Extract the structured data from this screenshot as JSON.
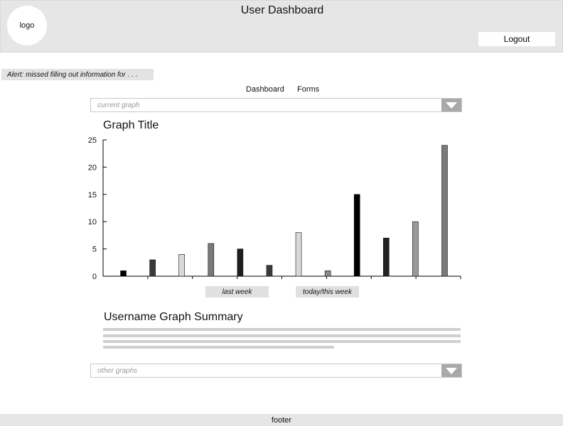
{
  "header": {
    "logo_text": "logo",
    "title": "User Dashboard",
    "logout_label": "Logout"
  },
  "alert": {
    "text": "Alert: missed filling out information for . . ."
  },
  "nav": {
    "items": [
      {
        "label": "Dashboard"
      },
      {
        "label": "Forms"
      }
    ]
  },
  "graph_select": {
    "placeholder": "current graph",
    "arrow_icon": "chevron-down-icon"
  },
  "graph": {
    "title": "Graph Title",
    "week_labels": [
      "last week",
      "today/this week"
    ]
  },
  "chart_data": {
    "type": "bar",
    "title": "Graph Title",
    "xlabel": "",
    "ylabel": "",
    "ylim": [
      0,
      25
    ],
    "yticks": [
      0,
      5,
      10,
      15,
      20,
      25
    ],
    "grid": false,
    "bars": [
      {
        "value": 1,
        "color": "#000000"
      },
      {
        "value": 3,
        "color": "#3a3a3a"
      },
      {
        "value": 4,
        "color": "#d9d9d9"
      },
      {
        "value": 6,
        "color": "#7a7a7a"
      },
      {
        "value": 5,
        "color": "#1e1e1e"
      },
      {
        "value": 2,
        "color": "#3a3a3a"
      },
      {
        "value": 8,
        "color": "#d9d9d9"
      },
      {
        "value": 1,
        "color": "#8a8a8a"
      },
      {
        "value": 15,
        "color": "#000000"
      },
      {
        "value": 7,
        "color": "#222222"
      },
      {
        "value": 10,
        "color": "#9a9a9a"
      },
      {
        "value": 24,
        "color": "#7a7a7a"
      }
    ]
  },
  "summary": {
    "title": "Username Graph Summary"
  },
  "other_select": {
    "placeholder": "other graphs",
    "arrow_icon": "chevron-down-icon"
  },
  "footer": {
    "text": "footer"
  }
}
